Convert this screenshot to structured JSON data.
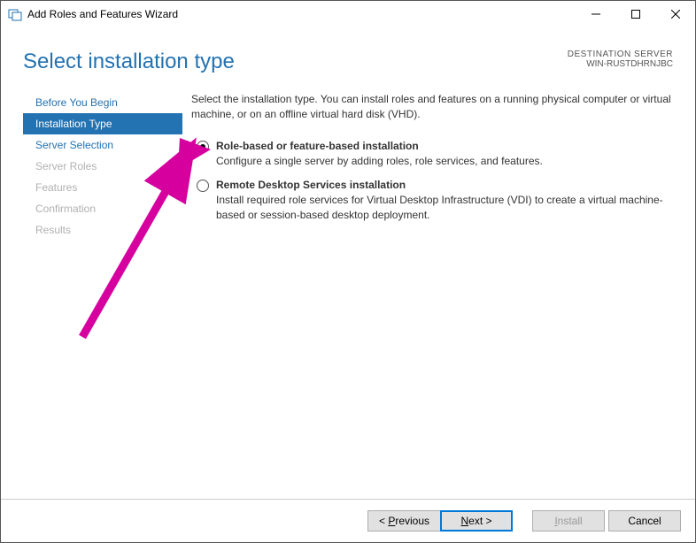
{
  "titlebar": {
    "text": "Add Roles and Features Wizard"
  },
  "header": {
    "title": "Select installation type",
    "dest_label": "DESTINATION SERVER",
    "dest_value": "WIN-RUSTDHRNJBC"
  },
  "sidebar": {
    "items": [
      {
        "label": "Before You Begin",
        "state": "normal"
      },
      {
        "label": "Installation Type",
        "state": "active"
      },
      {
        "label": "Server Selection",
        "state": "normal"
      },
      {
        "label": "Server Roles",
        "state": "disabled"
      },
      {
        "label": "Features",
        "state": "disabled"
      },
      {
        "label": "Confirmation",
        "state": "disabled"
      },
      {
        "label": "Results",
        "state": "disabled"
      }
    ]
  },
  "main": {
    "intro": "Select the installation type. You can install roles and features on a running physical computer or virtual machine, or on an offline virtual hard disk (VHD).",
    "options": [
      {
        "title": "Role-based or feature-based installation",
        "desc": "Configure a single server by adding roles, role services, and features.",
        "selected": true
      },
      {
        "title": "Remote Desktop Services installation",
        "desc": "Install required role services for Virtual Desktop Infrastructure (VDI) to create a virtual machine-based or session-based desktop deployment.",
        "selected": false
      }
    ]
  },
  "footer": {
    "previous": "Previous",
    "next": "Next >",
    "install": "Install",
    "cancel": "Cancel"
  }
}
